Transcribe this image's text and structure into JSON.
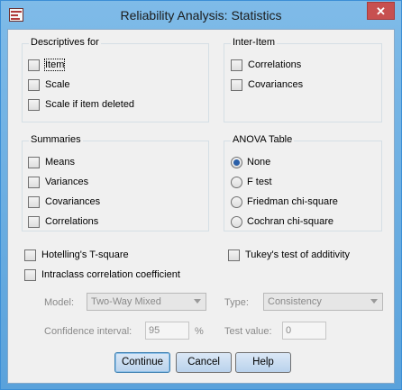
{
  "window": {
    "title": "Reliability Analysis: Statistics",
    "close_glyph": "✕",
    "app_icon": "spss-dialog-icon"
  },
  "descriptives": {
    "title": "Descriptives for",
    "items": [
      {
        "label": "Item",
        "checked": false
      },
      {
        "label": "Scale",
        "checked": false
      },
      {
        "label": "Scale if item deleted",
        "checked": false
      }
    ]
  },
  "inter_item": {
    "title": "Inter-Item",
    "items": [
      {
        "label": "Correlations",
        "checked": false
      },
      {
        "label": "Covariances",
        "checked": false
      }
    ]
  },
  "summaries": {
    "title": "Summaries",
    "items": [
      {
        "label": "Means",
        "checked": false
      },
      {
        "label": "Variances",
        "checked": false
      },
      {
        "label": "Covariances",
        "checked": false
      },
      {
        "label": "Correlations",
        "checked": false
      }
    ]
  },
  "anova": {
    "title": "ANOVA Table",
    "options": [
      {
        "label": "None",
        "selected": true
      },
      {
        "label": "F test",
        "selected": false
      },
      {
        "label": "Friedman chi-square",
        "selected": false
      },
      {
        "label": "Cochran chi-square",
        "selected": false
      }
    ]
  },
  "extra": {
    "hotelling": "Hotelling's T-square",
    "tukey": "Tukey's test of additivity",
    "icc": "Intraclass correlation coefficient"
  },
  "icc": {
    "model_label": "Model:",
    "model_value": "Two-Way Mixed",
    "type_label": "Type:",
    "type_value": "Consistency",
    "ci_label": "Confidence interval:",
    "ci_value": "95",
    "ci_unit": "%",
    "test_label": "Test value:",
    "test_value": "0"
  },
  "buttons": {
    "continue": "Continue",
    "cancel": "Cancel",
    "help": "Help"
  },
  "colors": {
    "title_bar": "#6aaee2",
    "close_button": "#c75050",
    "dialog_background": "#f0f0f0",
    "radio_selected": "#2a5fa8"
  }
}
